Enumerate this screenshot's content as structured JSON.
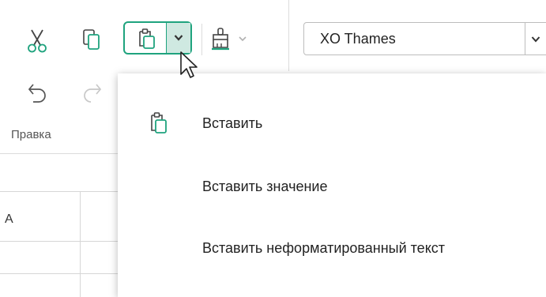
{
  "toolbar": {
    "font_name": "XO Thames",
    "group_label": "Правка"
  },
  "sheet": {
    "column_a": "A"
  },
  "menu": {
    "items": [
      {
        "label": "Вставить",
        "icon": "paste-icon"
      },
      {
        "label": "Вставить значение"
      },
      {
        "label": "Вставить неформатированный текст"
      }
    ]
  },
  "colors": {
    "accent": "#1fa37e",
    "accent_light": "#cfe9e1"
  }
}
